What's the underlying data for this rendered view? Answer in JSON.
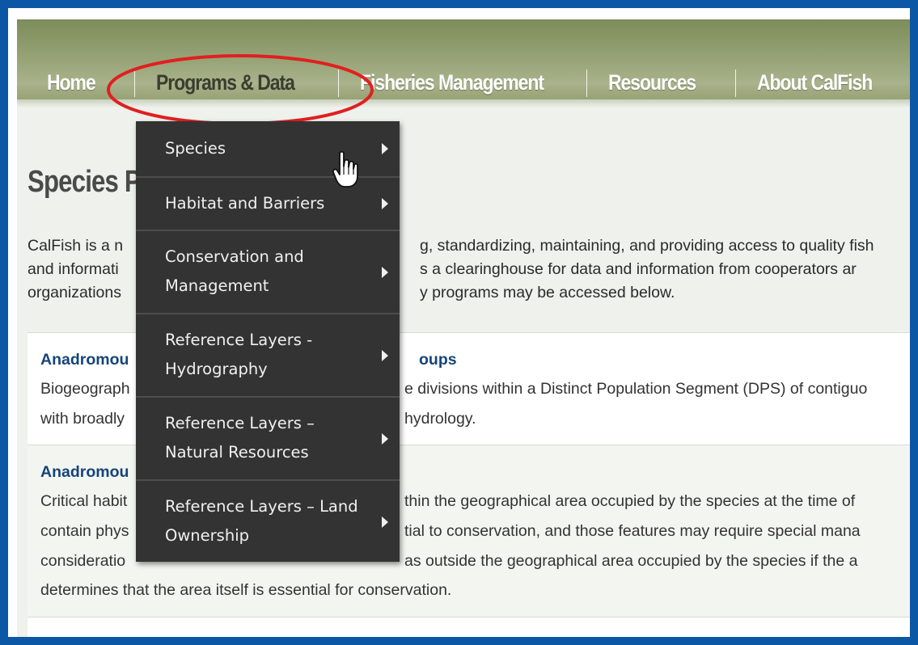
{
  "nav": {
    "items": [
      {
        "label": "Home"
      },
      {
        "label": "Programs & Data"
      },
      {
        "label": "Fisheries Management"
      },
      {
        "label": "Resources"
      },
      {
        "label": "About CalFish"
      }
    ],
    "active_index": 1,
    "highlight_color": "#e02020"
  },
  "page": {
    "title": "Species P",
    "intro_lines": [
      "CalFish is a n",
      "and informati",
      "organizations",
      "g, standardizing, maintaining, and providing access to quality fish",
      "s a clearinghouse for data and information from cooperators ar",
      "y programs may be accessed below."
    ]
  },
  "cards": [
    {
      "title_left": "Anadromou",
      "title_right": "oups",
      "lines_left": [
        "Biogeograph",
        "with broadly"
      ],
      "lines_right": [
        "e divisions within a Distinct Population Segment (DPS) of contiguo",
        "hydrology."
      ]
    },
    {
      "title_left": "Anadromou",
      "lines_left": [
        "Critical habit",
        "contain phys",
        "consideratio"
      ],
      "lines_right": [
        "thin the geographical area occupied by the species at the time of",
        "tial to conservation, and those features may require special mana",
        "as outside the geographical area occupied by the species if the a"
      ],
      "last_line": "determines that the area itself is essential for conservation."
    }
  ],
  "dropdown": {
    "items": [
      {
        "label_lines": [
          "Species"
        ]
      },
      {
        "label_lines": [
          "Habitat and Barriers"
        ]
      },
      {
        "label_lines": [
          "Conservation and",
          "Management"
        ]
      },
      {
        "label_lines": [
          "Reference Layers -",
          "Hydrography"
        ]
      },
      {
        "label_lines": [
          "Reference Layers –",
          "Natural Resources"
        ]
      },
      {
        "label_lines": [
          "Reference Layers – Land",
          "Ownership"
        ]
      }
    ],
    "background": "#333333"
  },
  "colors": {
    "frame_border": "#0c56a6",
    "link": "#16447a"
  }
}
